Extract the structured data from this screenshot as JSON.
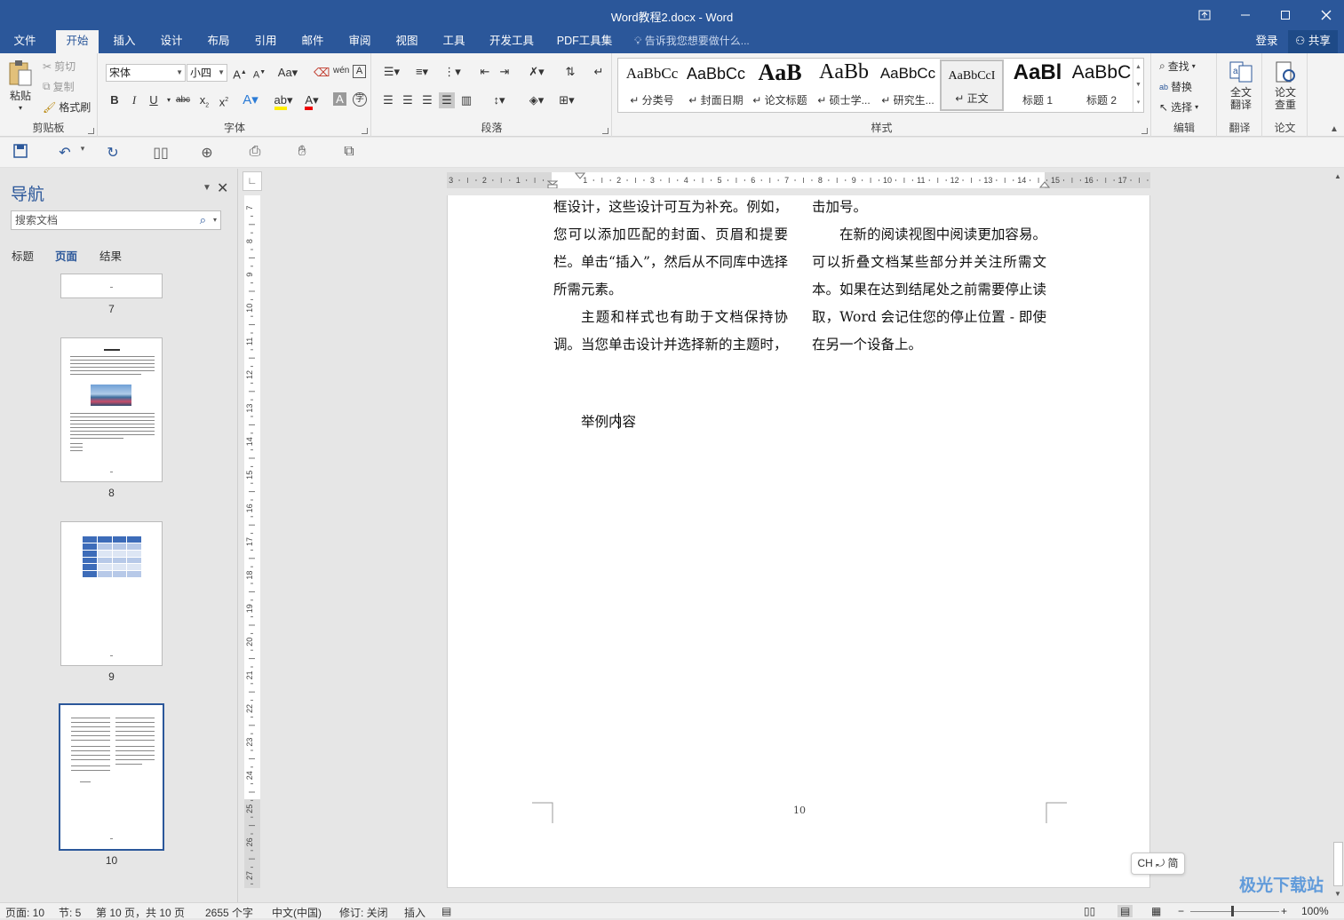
{
  "window": {
    "title": "Word教程2.docx - Word",
    "controls": [
      "restore-ribbon",
      "minimize",
      "maximize",
      "close"
    ]
  },
  "tabs": [
    {
      "label": "文件",
      "active": false
    },
    {
      "label": "开始",
      "active": true
    },
    {
      "label": "插入",
      "active": false
    },
    {
      "label": "设计",
      "active": false
    },
    {
      "label": "布局",
      "active": false
    },
    {
      "label": "引用",
      "active": false
    },
    {
      "label": "邮件",
      "active": false
    },
    {
      "label": "审阅",
      "active": false
    },
    {
      "label": "视图",
      "active": false
    },
    {
      "label": "工具",
      "active": false
    },
    {
      "label": "开发工具",
      "active": false
    },
    {
      "label": "PDF工具集",
      "active": false
    }
  ],
  "tell_me": "告诉我您想要做什么...",
  "account": {
    "signin": "登录",
    "share": "共享"
  },
  "clipboard": {
    "paste": "粘贴",
    "cut": "剪切",
    "copy": "复制",
    "format_painter": "格式刷",
    "label": "剪贴板"
  },
  "font": {
    "name": "宋体",
    "size": "小四",
    "label": "字体"
  },
  "paragraph": {
    "label": "段落"
  },
  "styles": {
    "label": "样式",
    "items": [
      {
        "sample": "AaBbCc",
        "name": "↵ 分类号",
        "selected": false
      },
      {
        "sample": "AaBbCc",
        "name": "↵ 封面日期",
        "selected": false
      },
      {
        "sample": "AaB",
        "name": "↵ 论文标题",
        "selected": false
      },
      {
        "sample": "AaBb",
        "name": "↵ 硕士学...",
        "selected": false
      },
      {
        "sample": "AaBbCc",
        "name": "↵ 研究生...",
        "selected": false
      },
      {
        "sample": "AaBbCcI",
        "name": "↵ 正文",
        "selected": true
      },
      {
        "sample": "AaBl",
        "name": "标题 1",
        "selected": false
      },
      {
        "sample": "AaBbC",
        "name": "标题 2",
        "selected": false
      }
    ]
  },
  "editing": {
    "find": "查找",
    "replace": "替换",
    "select": "选择",
    "label": "编辑"
  },
  "translate": {
    "button": "全文翻译",
    "label": "翻译"
  },
  "paper": {
    "button": "论文查重",
    "label": "论文"
  },
  "nav": {
    "title": "导航",
    "search_placeholder": "搜索文档",
    "tabs": [
      {
        "label": "标题",
        "active": false
      },
      {
        "label": "页面",
        "active": true
      },
      {
        "label": "结果",
        "active": false
      }
    ],
    "pages": [
      "7",
      "8",
      "9",
      "10"
    ]
  },
  "ruler": {
    "h_labels": [
      "3",
      "2",
      "1",
      "1",
      "2",
      "3",
      "4",
      "5",
      "6",
      "7",
      "8",
      "9",
      "10",
      "11",
      "12",
      "13",
      "14",
      "15",
      "16",
      "17"
    ],
    "v_labels": [
      "7",
      "8",
      "9",
      "10",
      "11",
      "12",
      "13",
      "14",
      "15",
      "16",
      "17",
      "18",
      "19",
      "20",
      "21",
      "22",
      "23",
      "24",
      "25",
      "26",
      "27"
    ]
  },
  "document": {
    "left_col": [
      {
        "text": "框设计，这些设计可互为补充。例如，您可以添加匹配的封面、页眉和提要栏。单击“插入”，然后从不同库中选择所需元素。",
        "indent": false
      },
      {
        "text": "主题和样式也有助于文档保持协调。当您单击设计并选择新的主题时，",
        "indent": true
      }
    ],
    "right_col": [
      {
        "text": "击加号。",
        "indent": false
      },
      {
        "text": "在新的阅读视图中阅读更加容易。可以折叠文档某些部分并关注所需文本。如果在达到结尾处之前需要停止读取，Word 会记住您的停止位置 - 即使在另一个设备上。",
        "indent": true
      }
    ],
    "example_text": "举例内容",
    "page_number": "10"
  },
  "ime": "CH ⤾ 简",
  "status": {
    "page": "页面: 10",
    "section": "节: 5",
    "page_of": "第 10 页，共 10 页",
    "words": "2655 个字",
    "language": "中文(中国)",
    "track": "修订: 关闭",
    "mode": "插入",
    "zoom": "100%"
  },
  "watermark": "极光下载站"
}
